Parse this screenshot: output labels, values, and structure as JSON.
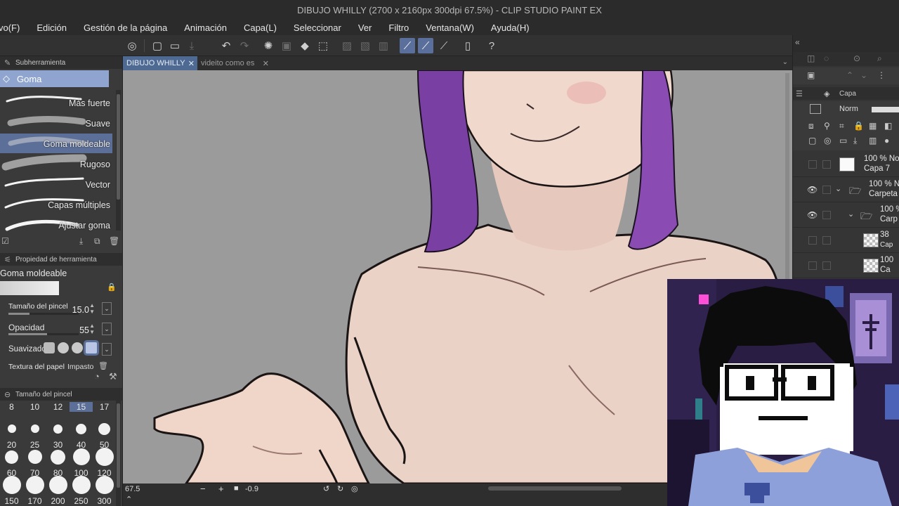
{
  "window": {
    "title": "DIBUJO WHILLY (2700 x 2160px 300dpi 67.5%)  - CLIP STUDIO PAINT EX"
  },
  "menu": [
    "vo(F)",
    "Edición",
    "Gestión de la página",
    "Animación",
    "Capa(L)",
    "Seleccionar",
    "Ver",
    "Filtro",
    "Ventana(W)",
    "Ayuda(H)"
  ],
  "subtool_panel": {
    "header": "Subherramienta",
    "group": "Goma",
    "items": [
      {
        "label": "Más fuerte"
      },
      {
        "label": "Suave"
      },
      {
        "label": "Goma moldeable",
        "selected": true
      },
      {
        "label": "Rugoso"
      },
      {
        "label": "Vector"
      },
      {
        "label": "Capas múltiples"
      },
      {
        "label": "Ajustar goma"
      }
    ]
  },
  "tool_property": {
    "header": "Propiedad de herramienta",
    "name": "Goma moldeable",
    "brush_size": {
      "label": "Tamaño del pincel",
      "value": "15.0"
    },
    "opacity": {
      "label": "Opacidad",
      "value": "55"
    },
    "smoothing": {
      "label": "Suavizado"
    },
    "texture": {
      "label": "Textura del papel",
      "value": "Impasto"
    }
  },
  "brush_size_panel": {
    "header": "Tamaño del pincel",
    "sizes": [
      "8",
      "10",
      "12",
      "15",
      "17",
      "20",
      "25",
      "30",
      "40",
      "50",
      "60",
      "70",
      "80",
      "100",
      "120",
      "150",
      "170",
      "200",
      "250",
      "300"
    ],
    "selected": "15"
  },
  "tabs": [
    {
      "label": "DIBUJO WHILLY",
      "active": true
    },
    {
      "label": "videito como es",
      "active": false
    }
  ],
  "status": {
    "zoom": "67.5",
    "rotation": "-0.9"
  },
  "layer_panel": {
    "header": "Capa",
    "blend_mode": "Norm",
    "layers": [
      {
        "opacity": "100 %",
        "blend": "No",
        "name": "Capa 7"
      },
      {
        "opacity": "100 %",
        "blend": "N",
        "name": "Carpeta"
      },
      {
        "opacity": "100 %",
        "blend": "",
        "name": "Carp"
      },
      {
        "opacity": "38",
        "blend": "",
        "name": "Cap"
      },
      {
        "opacity": "100",
        "blend": "",
        "name": "Ca"
      }
    ]
  },
  "colors": {
    "accent": "#5c6f98",
    "selected_subtool": "#8fa5cf",
    "canvas_bg": "#9b9b9b",
    "skin": "#ead2c6",
    "hair": "#7a3fa3"
  }
}
